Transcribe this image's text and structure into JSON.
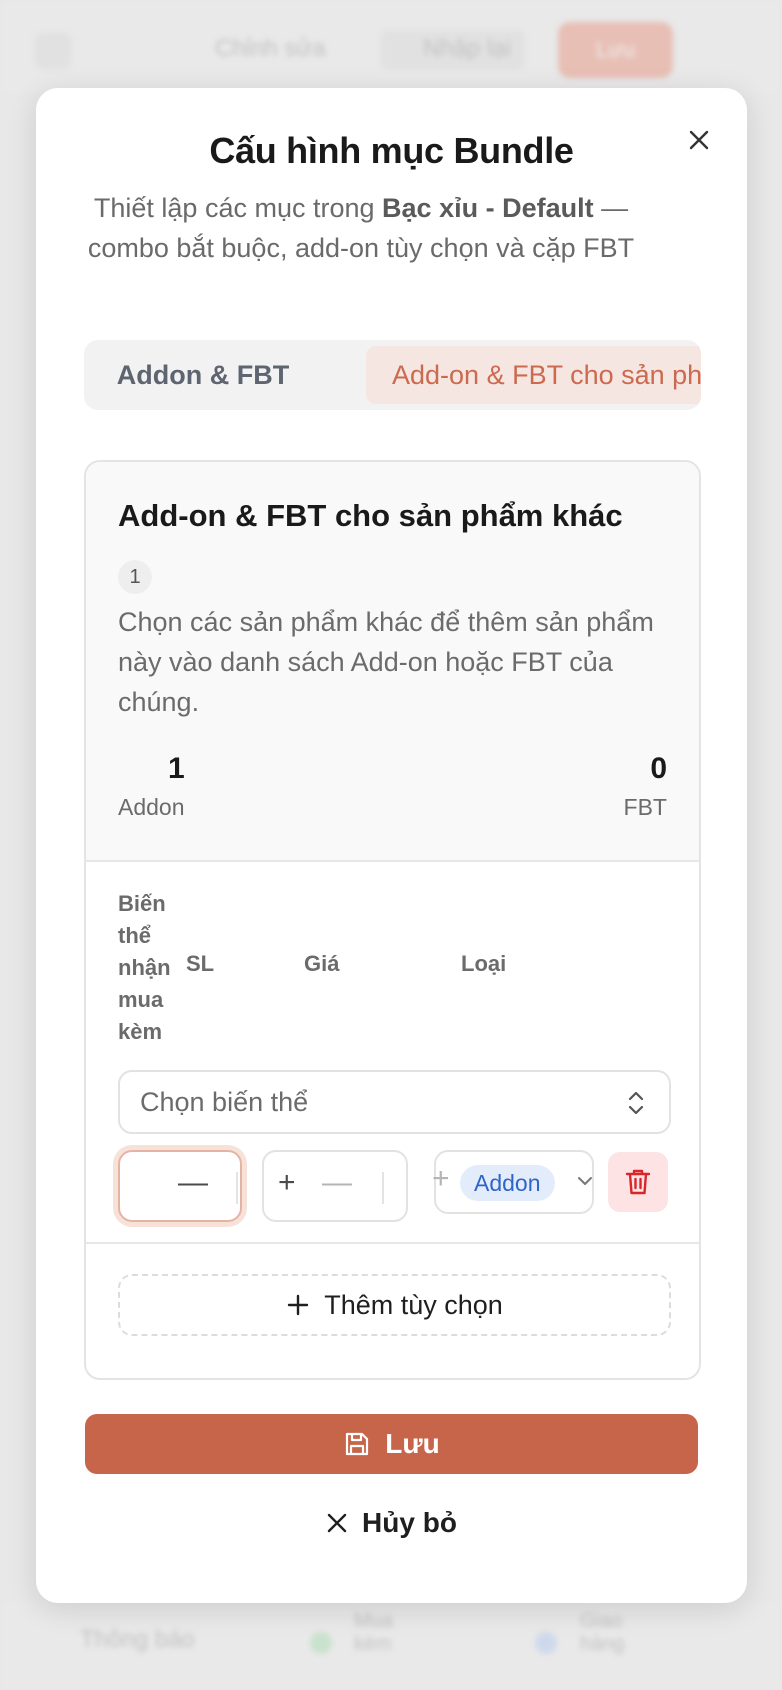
{
  "background": {
    "top_items": [
      "Chỉnh sửa",
      "Nhập lại",
      "Lưu"
    ],
    "bottom_items": [
      "Thông báo",
      "Mua kèm",
      "Giao hàng"
    ]
  },
  "modal": {
    "title": "Cấu hình mục Bundle",
    "description_prefix": "Thiết lập các mục trong ",
    "description_bold": "Bạc xỉu - Default",
    "description_suffix": " — combo bắt buộc, add-on tùy chọn và cặp FBT",
    "tabs": [
      {
        "label": "Addon & FBT",
        "active": false
      },
      {
        "label": "Add-on & FBT cho sản phẩm khác",
        "active": true
      }
    ],
    "section": {
      "title": "Add-on & FBT cho sản phẩm khác",
      "count": "1",
      "description": "Chọn các sản phẩm khác để thêm sản phẩm này vào danh sách Add-on hoặc FBT của chúng.",
      "stats": {
        "addon_value": "1",
        "addon_label": "Addon",
        "fbt_value": "0",
        "fbt_label": "FBT"
      },
      "columns": {
        "variant": "Biến thể nhận mua kèm",
        "qty": "SL",
        "price": "Giá",
        "type": "Loại"
      },
      "row": {
        "variant_placeholder": "Chọn biến thể",
        "type_value": "Addon"
      },
      "add_option_label": "Thêm tùy chọn"
    },
    "save_label": "Lưu",
    "cancel_label": "Hủy bỏ"
  },
  "colors": {
    "accent": "#c7654a",
    "tab_active_bg": "#f6e6e1",
    "pill_bg": "#e3ecfb",
    "pill_text": "#2f65c8",
    "danger": "#d9262b"
  }
}
